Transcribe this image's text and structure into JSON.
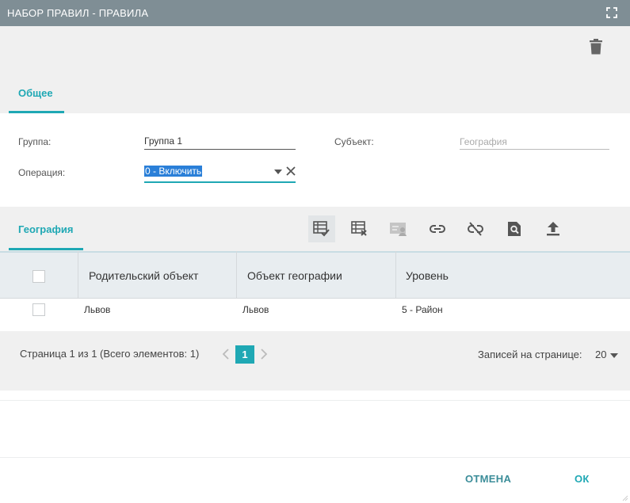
{
  "window": {
    "title": "НАБОР ПРАВИЛ - ПРАВИЛА"
  },
  "tabs": {
    "general": "Общее"
  },
  "form": {
    "group_label": "Группа:",
    "group_value": "Группа 1",
    "subject_label": "Субъект:",
    "subject_placeholder": "География",
    "operation_label": "Операция:",
    "operation_value": "0 - Включить"
  },
  "grid": {
    "tab_label": "География",
    "columns": [
      "Родительский объект",
      "Объект географии",
      "Уровень"
    ],
    "rows": [
      {
        "parent": "Львов",
        "object": "Львов",
        "level": "5 - Район"
      }
    ]
  },
  "pager": {
    "summary": "Страница 1 из 1 (Всего элементов: 1)",
    "current_page": "1",
    "per_page_label": "Записей на странице:",
    "per_page_value": "20"
  },
  "footer": {
    "cancel": "ОТМЕНА",
    "ok": "ОК"
  },
  "colors": {
    "accent": "#1fa8b4",
    "titlebar": "#7f8e95",
    "selection": "#2a7fd8"
  }
}
